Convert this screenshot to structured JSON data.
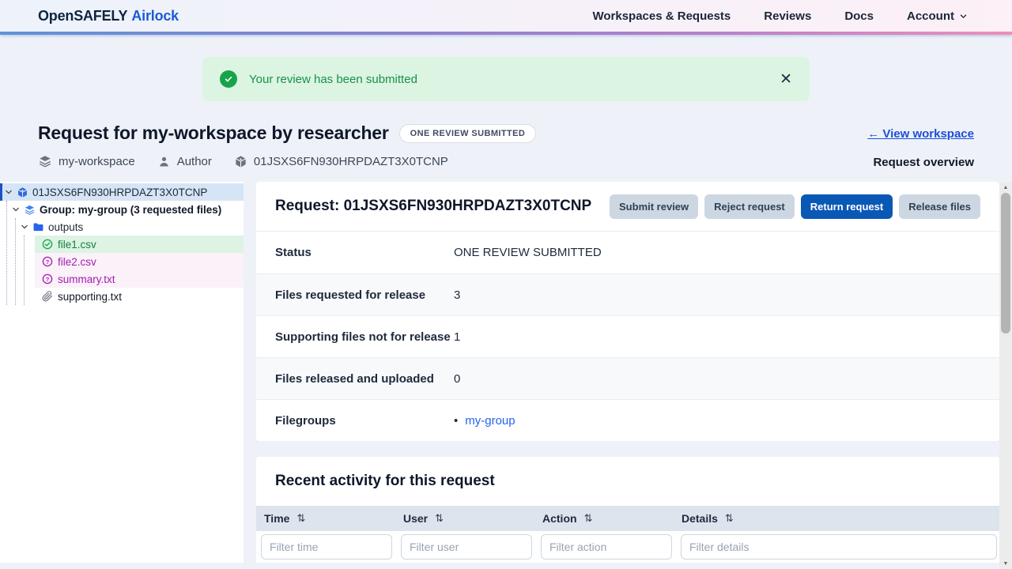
{
  "brand": {
    "name": "OpenSAFELY",
    "product": "Airlock"
  },
  "nav": {
    "items": [
      {
        "label": "Workspaces & Requests"
      },
      {
        "label": "Reviews"
      },
      {
        "label": "Docs"
      },
      {
        "label": "Account"
      }
    ]
  },
  "alert": {
    "message": "Your review has been submitted",
    "close_label": "✕"
  },
  "page": {
    "title": "Request for my-workspace by researcher",
    "status_badge": "ONE REVIEW SUBMITTED",
    "workspace": "my-workspace",
    "author": "Author",
    "request_id": "01JSXS6FN930HRPDAZT3X0TCNP",
    "view_workspace_link": "← View workspace",
    "overview_label": "Request overview"
  },
  "tree": {
    "root": {
      "label": "01JSXS6FN930HRPDAZT3X0TCNP"
    },
    "group": {
      "label": "Group: my-group (3 requested files)"
    },
    "folder": {
      "label": "outputs"
    },
    "files": [
      {
        "label": "file1.csv",
        "status": "approved"
      },
      {
        "label": "file2.csv",
        "status": "undecided"
      },
      {
        "label": "summary.txt",
        "status": "undecided"
      },
      {
        "label": "supporting.txt",
        "status": "supporting"
      }
    ]
  },
  "request_card": {
    "title": "Request: 01JSXS6FN930HRPDAZT3X0TCNP",
    "buttons": [
      {
        "label": "Submit review",
        "style": "secondary"
      },
      {
        "label": "Reject request",
        "style": "secondary"
      },
      {
        "label": "Return request",
        "style": "primary"
      },
      {
        "label": "Release files",
        "style": "secondary"
      }
    ],
    "details": [
      {
        "label": "Status",
        "value": "ONE REVIEW SUBMITTED"
      },
      {
        "label": "Files requested for release",
        "value": "3"
      },
      {
        "label": "Supporting files not for release",
        "value": "1"
      },
      {
        "label": "Files released and uploaded",
        "value": "0"
      },
      {
        "label": "Filegroups",
        "value": "my-group"
      }
    ],
    "filegroups_bullet": "•"
  },
  "activity": {
    "title": "Recent activity for this request",
    "sort_glyph": "⇅",
    "columns": [
      {
        "label": "Time",
        "filter_placeholder": "Filter time"
      },
      {
        "label": "User",
        "filter_placeholder": "Filter user"
      },
      {
        "label": "Action",
        "filter_placeholder": "Filter action"
      },
      {
        "label": "Details",
        "filter_placeholder": "Filter details"
      }
    ]
  },
  "scrollbar": {
    "up": "▲",
    "down": "▼"
  },
  "colors": {
    "accent_blue": "#0a58b6",
    "link_blue": "#1d4ed8",
    "success_green": "#15803d",
    "approved_green": "#16a34a",
    "undecided_purple": "#a21caf",
    "selected_row_blue": "#d5e5f6"
  }
}
